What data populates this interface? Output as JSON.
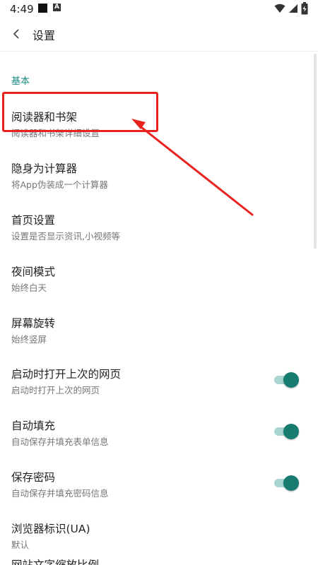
{
  "status_bar": {
    "time": "4:49",
    "notif_letter": "A"
  },
  "app_bar": {
    "title": "设置"
  },
  "section": {
    "title": "基本"
  },
  "items": [
    {
      "title": "阅读器和书架",
      "subtitle": "阅读器和书架详细设置"
    },
    {
      "title": "隐身为计算器",
      "subtitle": "将App伪装成一个计算器"
    },
    {
      "title": "首页设置",
      "subtitle": "设置是否显示资讯,小视频等"
    },
    {
      "title": "夜间模式",
      "subtitle": "始终白天"
    },
    {
      "title": "屏幕旋转",
      "subtitle": "始终竖屏"
    },
    {
      "title": "启动时打开上次的网页",
      "subtitle": "启动时打开上次的网页",
      "toggle": true
    },
    {
      "title": "自动填充",
      "subtitle": "自动保存并填充表单信息",
      "toggle": true
    },
    {
      "title": "保存密码",
      "subtitle": "自动保存并填充密码信息",
      "toggle": true
    },
    {
      "title": "浏览器标识(UA)",
      "subtitle": "默认"
    },
    {
      "title": "网站文字缩放比例",
      "subtitle": ""
    }
  ],
  "colors": {
    "accent": "#1a8a84",
    "toggle_on": "#177b70",
    "annotation": "#e8231f"
  }
}
